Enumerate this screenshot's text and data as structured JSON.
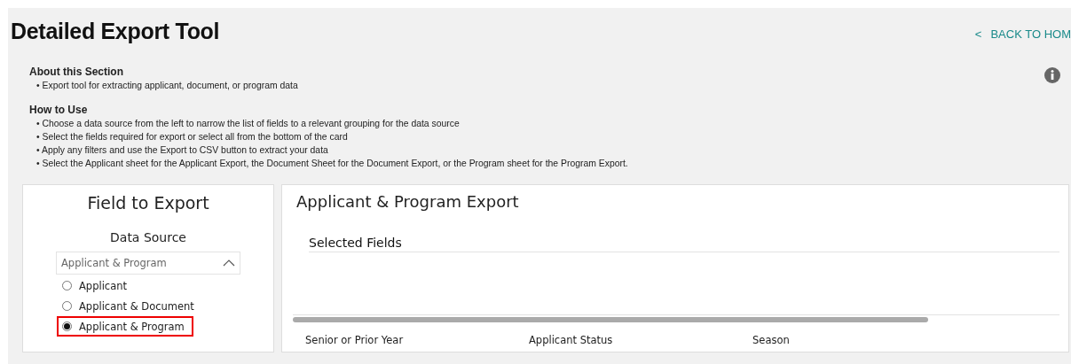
{
  "title": "Detailed Export Tool",
  "back_link": {
    "arrow": "<",
    "label": "BACK TO HOM"
  },
  "about": {
    "heading": "About this Section",
    "bullets": [
      "• Export tool for extracting applicant, document, or program data"
    ]
  },
  "how_to": {
    "heading": "How to Use",
    "bullets": [
      "• Choose a data source from the left to narrow the list of fields to a relevant grouping for the data source",
      "• Select the fields required for export or select all from the bottom of the card",
      "• Apply any filters and use the Export to CSV button to extract your data",
      "• Select the Applicant sheet for the Applicant Export, the Document Sheet for the Document Export, or the Program sheet for the Program Export."
    ]
  },
  "left_card": {
    "title": "Field to Export",
    "data_source": {
      "label": "Data Source",
      "value": "Applicant & Program",
      "expanded": true,
      "options": [
        {
          "label": "Applicant",
          "selected": false
        },
        {
          "label": "Applicant & Document",
          "selected": false
        },
        {
          "label": "Applicant & Program",
          "selected": true
        }
      ]
    }
  },
  "right_card": {
    "title": "Applicant & Program Export",
    "section": "Selected Fields",
    "filters": [
      "Senior or Prior Year",
      "Applicant Status",
      "Season"
    ]
  }
}
